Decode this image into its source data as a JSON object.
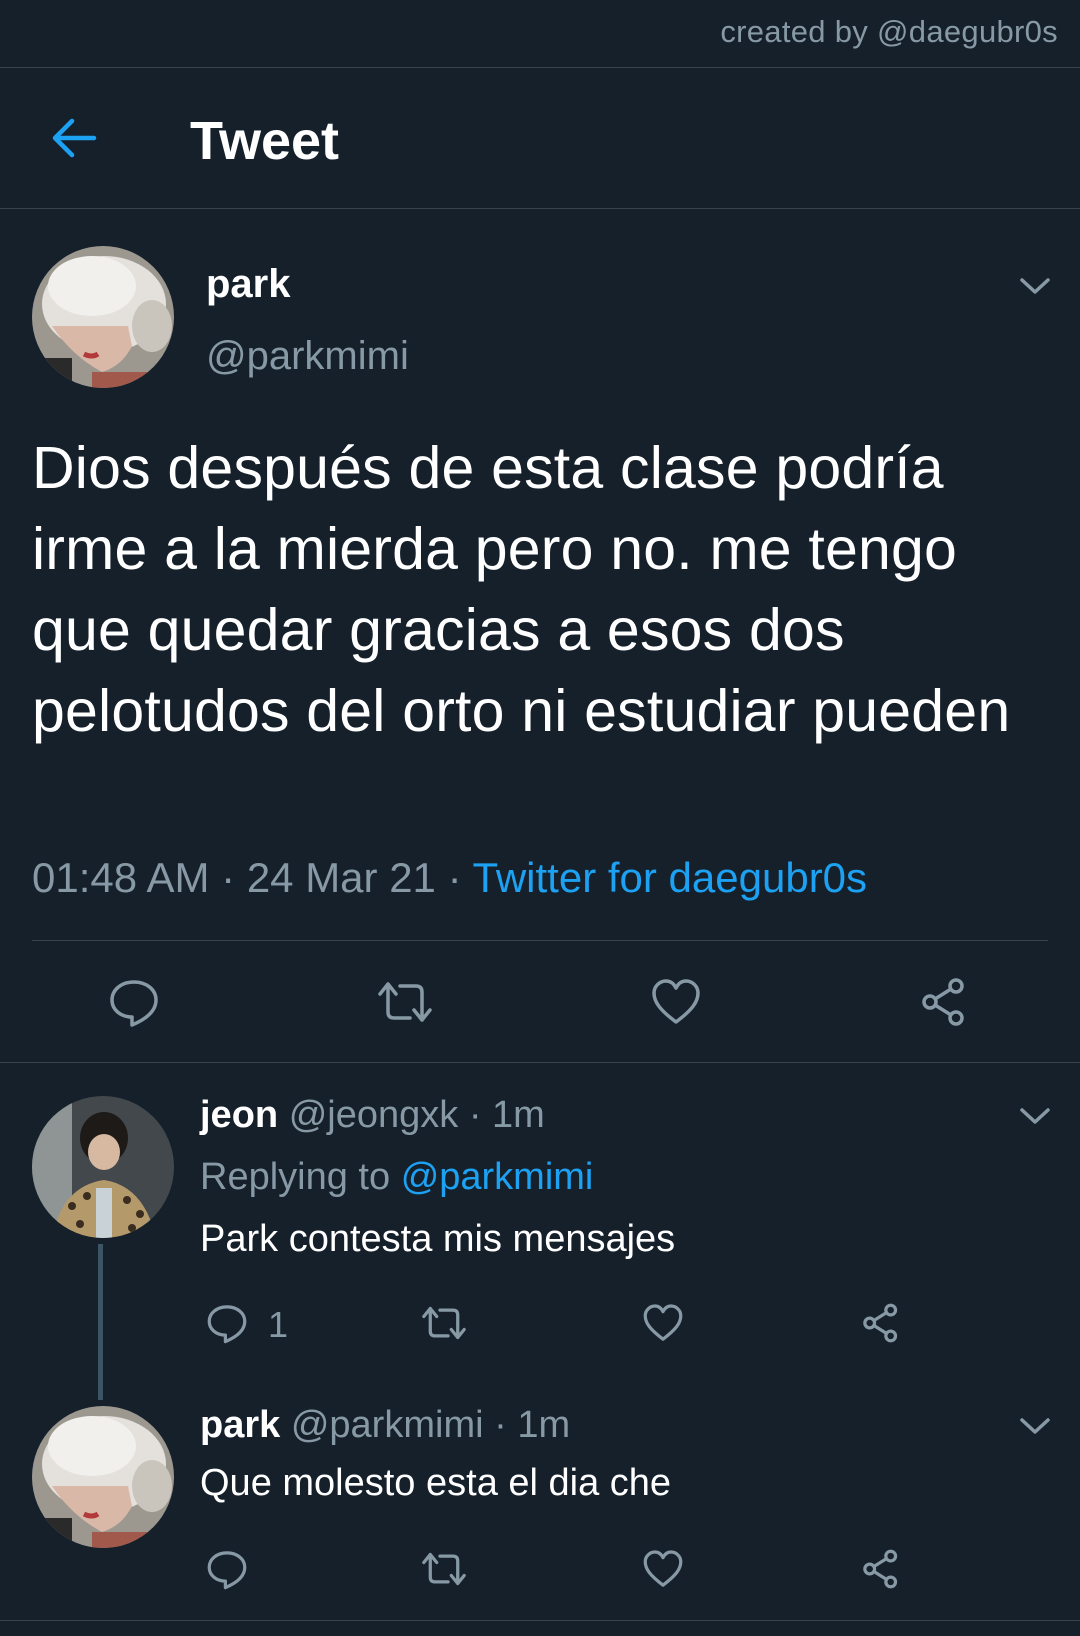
{
  "credit": "created by @daegubr0s",
  "header": {
    "title": "Tweet",
    "back_icon": "back-arrow-icon"
  },
  "colors": {
    "background": "#15202b",
    "accent": "#1da1f2",
    "muted": "#8899a6",
    "divider": "#38444d"
  },
  "main_tweet": {
    "name": "park",
    "handle": "@parkmimi",
    "text": "Dios después de esta clase podría irme a la mierda pero no. me tengo que quedar gracias a esos dos pelotudos del orto ni estudiar pueden",
    "time": "01:48 AM",
    "date": "24 Mar 21",
    "separator": "·",
    "source": "Twitter for daegubr0s",
    "actions": [
      "reply-icon",
      "retweet-icon",
      "like-icon",
      "share-icon"
    ]
  },
  "replies": [
    {
      "name": "jeon",
      "handle": "@jeongxk",
      "age": "· 1m",
      "replying_label": "Replying to",
      "replying_handle": "@parkmimi",
      "text": "Park contesta mis mensajes",
      "reply_count": "1"
    },
    {
      "name": "park",
      "handle": "@parkmimi",
      "age": "· 1m",
      "text": "Que molesto esta el dia che",
      "reply_count": ""
    }
  ]
}
